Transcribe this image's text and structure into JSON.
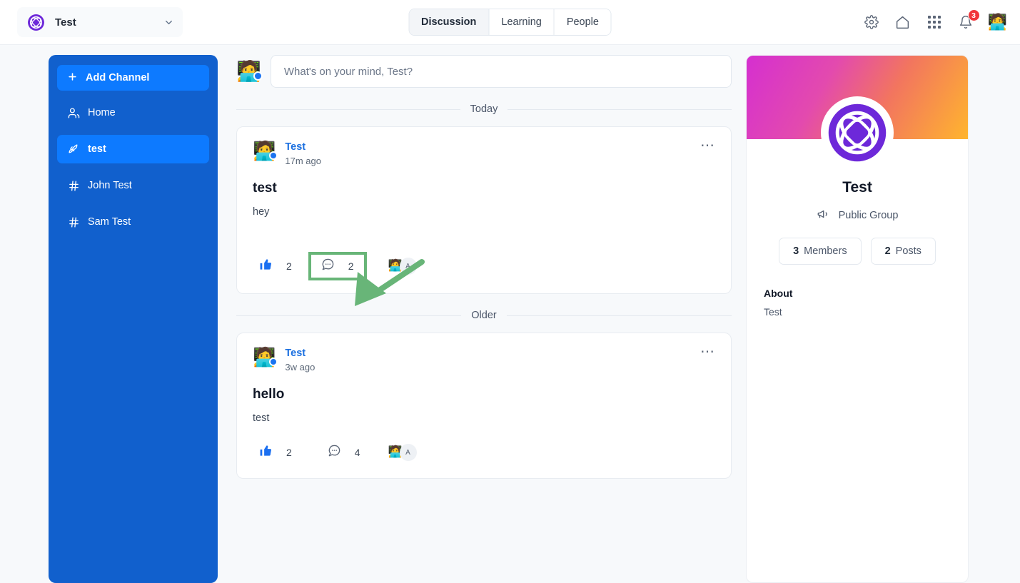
{
  "topbar": {
    "brand_name": "Test",
    "brand_logo_icon": "atom-logo-icon",
    "chevron_icon": "chevron-down-icon",
    "tabs": [
      {
        "label": "Discussion",
        "active": true
      },
      {
        "label": "Learning",
        "active": false
      },
      {
        "label": "People",
        "active": false
      }
    ],
    "actions": {
      "settings_icon": "gear-icon",
      "home_icon": "home-icon",
      "apps_icon": "grid-apps-icon",
      "notifications_icon": "bell-icon",
      "notifications_count": "3",
      "profile_avatar": "🧑‍💻"
    }
  },
  "sidebar": {
    "add_channel_label": "Add Channel",
    "add_channel_icon": "plus-icon",
    "items": [
      {
        "label": "Home",
        "icon": "people-icon",
        "active": false
      },
      {
        "label": "test",
        "icon": "rocket-icon",
        "active": true
      },
      {
        "label": "John Test",
        "icon": "hash-icon",
        "active": false
      },
      {
        "label": "Sam Test",
        "icon": "hash-icon",
        "active": false
      }
    ]
  },
  "feed": {
    "composer": {
      "avatar": "🧑‍💻",
      "placeholder": "What's on your mind, Test?",
      "value": ""
    },
    "dividers": {
      "today": "Today",
      "older": "Older"
    },
    "posts": [
      {
        "avatar": "🧑‍💻",
        "author": "Test",
        "time": "17m ago",
        "title": "test",
        "body": "hey",
        "like_count": "2",
        "comment_count": "2",
        "menu_icon": "more-options-icon",
        "like_icon": "thumbs-up-icon",
        "comment_icon": "comment-bubble-icon",
        "reactor_emoji": "🧑‍💻",
        "reactor_initial": "A",
        "comment_highlighted": true
      },
      {
        "avatar": "🧑‍💻",
        "author": "Test",
        "time": "3w ago",
        "title": "hello",
        "body": "test",
        "like_count": "2",
        "comment_count": "4",
        "menu_icon": "more-options-icon",
        "like_icon": "thumbs-up-icon",
        "comment_icon": "comment-bubble-icon",
        "reactor_emoji": "🧑‍💻",
        "reactor_initial": "A",
        "comment_highlighted": false
      }
    ]
  },
  "rightpanel": {
    "group_logo_icon": "atom-logo-icon",
    "group_name": "Test",
    "group_type": "Public Group",
    "group_type_icon": "megaphone-icon",
    "stats": [
      {
        "value": "3",
        "label": "Members"
      },
      {
        "value": "2",
        "label": "Posts"
      }
    ],
    "about_heading": "About",
    "about_text": "Test"
  },
  "annotation": {
    "arrow_icon": "arrow-pointer-icon",
    "highlight_color": "#68b578",
    "arrow_color": "#68b578"
  },
  "colors": {
    "sidebar_bg": "#1160cd",
    "sidebar_active": "#0d7aff",
    "page_bg": "#f7f9fb",
    "brand_purple": "#6d28d9",
    "link_blue": "#1a6fe0",
    "badge_red": "#f1353a"
  }
}
